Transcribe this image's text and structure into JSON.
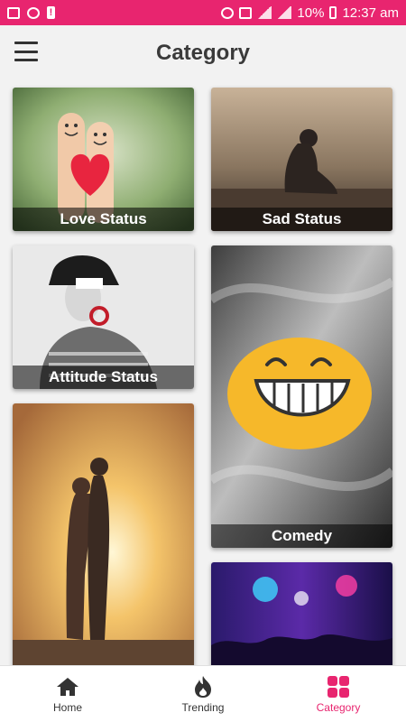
{
  "status_bar": {
    "battery": "10%",
    "time": "12:37 am"
  },
  "header": {
    "title": "Category"
  },
  "categories": [
    {
      "label": "Love Status"
    },
    {
      "label": "Sad Status"
    },
    {
      "label": "Attitude Status"
    },
    {
      "label": "Comedy"
    },
    {
      "label": ""
    },
    {
      "label": ""
    }
  ],
  "bottom_nav": {
    "items": [
      {
        "label": "Home",
        "icon": "home-icon"
      },
      {
        "label": "Trending",
        "icon": "flame-icon"
      },
      {
        "label": "Category",
        "icon": "grid-icon"
      }
    ],
    "active": "Category"
  },
  "colors": {
    "accent": "#e8256f",
    "background": "#f2f2f2",
    "title": "#3a3a3a"
  }
}
